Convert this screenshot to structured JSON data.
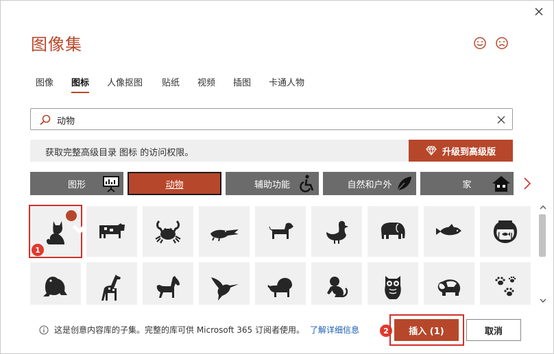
{
  "dialog": {
    "title": "图像集",
    "feedback": {
      "smile": "smile-icon",
      "frown": "frown-icon"
    }
  },
  "tabs": [
    {
      "label": "图像",
      "active": false
    },
    {
      "label": "图标",
      "active": true
    },
    {
      "label": "人像抠图",
      "active": false
    },
    {
      "label": "贴纸",
      "active": false
    },
    {
      "label": "视频",
      "active": false
    },
    {
      "label": "插图",
      "active": false
    },
    {
      "label": "卡通人物",
      "active": false
    }
  ],
  "search": {
    "value": "动物",
    "placeholder": ""
  },
  "premium": {
    "message": "获取完整高级目录 图标 的访问权限。",
    "upgrade_label": "升级到高级版"
  },
  "categories": [
    {
      "label": "图形",
      "icon": "presentation-icon",
      "active": false
    },
    {
      "label": "动物",
      "icon": "",
      "active": true
    },
    {
      "label": "辅助功能",
      "icon": "wheelchair-icon",
      "active": false
    },
    {
      "label": "自然和户外",
      "icon": "leaf-icon",
      "active": false
    },
    {
      "label": "家",
      "icon": "house-icon",
      "active": false
    }
  ],
  "icons": [
    {
      "name": "cat-icon",
      "selected": true
    },
    {
      "name": "cow-icon",
      "selected": false
    },
    {
      "name": "crab-icon",
      "selected": false
    },
    {
      "name": "alligator-icon",
      "selected": false
    },
    {
      "name": "dog-icon",
      "selected": false
    },
    {
      "name": "duck-icon",
      "selected": false
    },
    {
      "name": "elephant-icon",
      "selected": false
    },
    {
      "name": "fish-icon",
      "selected": false
    },
    {
      "name": "fishbowl-icon",
      "selected": false
    },
    {
      "name": "frog-icon",
      "selected": false
    },
    {
      "name": "giraffe-icon",
      "selected": false
    },
    {
      "name": "horse-icon",
      "selected": false
    },
    {
      "name": "hummingbird-icon",
      "selected": false
    },
    {
      "name": "lion-icon",
      "selected": false
    },
    {
      "name": "monkey-icon",
      "selected": false
    },
    {
      "name": "owl-icon",
      "selected": false
    },
    {
      "name": "panda-icon",
      "selected": false
    },
    {
      "name": "paw-prints-icon",
      "selected": false
    }
  ],
  "annotations": {
    "step1": "1",
    "step2": "2"
  },
  "footer": {
    "info": "这是创意内容库的子集。完整的库可供 Microsoft 365 订阅者使用。",
    "learn_more": "了解详细信息",
    "insert_label": "插入 (1)",
    "cancel_label": "取消"
  },
  "colors": {
    "accent": "#b7472a",
    "category_bg": "#6b6b6b",
    "highlight": "#d0302a"
  }
}
